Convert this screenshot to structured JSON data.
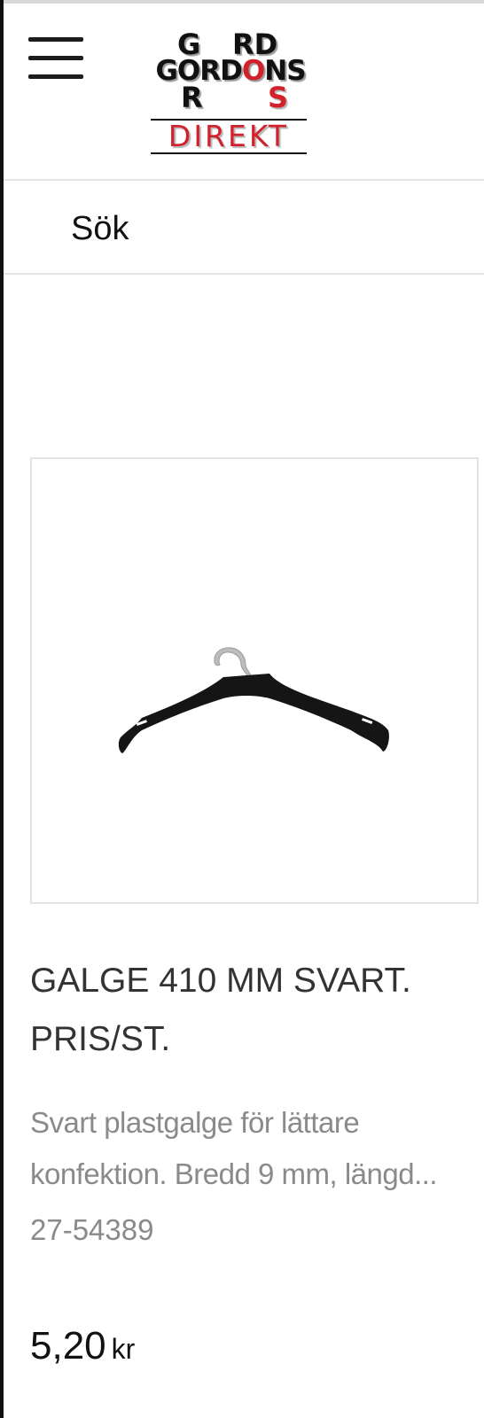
{
  "header": {
    "menu_icon": "hamburger-menu-icon",
    "logo": {
      "top_row_left": "G",
      "top_row_right": "RD",
      "middle_row_prefix": "G",
      "middle_row_o": "O",
      "middle_row_mid": "RD",
      "middle_row_red_o": "O",
      "middle_row_suffix": "NS",
      "bottom_row_left": "R",
      "bottom_row_right": "S",
      "sub_text": "DIREKT"
    }
  },
  "search": {
    "label": "Sök"
  },
  "product": {
    "image_icon": "clothes-hanger-image",
    "title": "GALGE 410 MM SVART. PRIS/ST.",
    "description": "Svart plastgalge för lättare konfektion. Bredd 9 mm, längd...",
    "sku": "27-54389",
    "price": "5,20",
    "currency": "kr"
  },
  "colors": {
    "logo_red": "#d3212b",
    "text_dark": "#333333",
    "text_muted": "#8a8a8a",
    "divider": "#e6e6e6"
  }
}
